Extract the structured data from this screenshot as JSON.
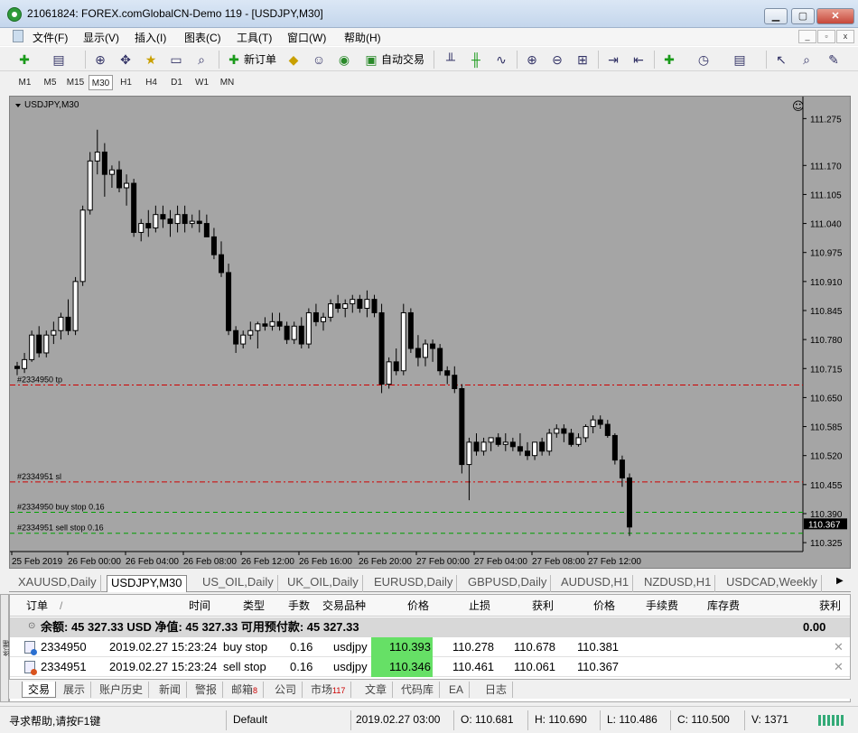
{
  "window": {
    "title": "21061824: FOREX.comGlobalCN-Demo 119 - [USDJPY,M30]"
  },
  "menu": [
    "文件(F)",
    "显示(V)",
    "插入(I)",
    "图表(C)",
    "工具(T)",
    "窗口(W)",
    "帮助(H)"
  ],
  "toolbar": {
    "new_order": "新订单",
    "auto_trade": "自动交易"
  },
  "timeframes": [
    "M1",
    "M5",
    "M15",
    "M30",
    "H1",
    "H4",
    "D1",
    "W1",
    "MN"
  ],
  "active_timeframe": "M30",
  "chart": {
    "symbol_label": "USDJPY,M30"
  },
  "chart_data": {
    "type": "candlestick",
    "title": "USDJPY,M30",
    "y_ticks": [
      "111.275",
      "111.170",
      "111.105",
      "111.040",
      "110.975",
      "110.910",
      "110.845",
      "110.780",
      "110.715",
      "110.650",
      "110.585",
      "110.520",
      "110.455",
      "110.390",
      "110.325"
    ],
    "x_ticks": [
      "25 Feb 2019",
      "26 Feb 00:00",
      "26 Feb 04:00",
      "26 Feb 08:00",
      "26 Feb 12:00",
      "26 Feb 16:00",
      "26 Feb 20:00",
      "27 Feb 00:00",
      "27 Feb 04:00",
      "27 Feb 08:00",
      "27 Feb 12:00"
    ],
    "current_price": "110.367",
    "ylim": [
      110.305,
      111.3
    ],
    "order_lines": [
      {
        "label": "#2334950 tp",
        "price": 110.678,
        "color": "#d00000",
        "style": "dashdot"
      },
      {
        "label": "#2334951 sl",
        "price": 110.461,
        "color": "#d00000",
        "style": "dashdot"
      },
      {
        "label": "#2334950 buy stop 0.16",
        "price": 110.393,
        "color": "#00a000",
        "style": "dash"
      },
      {
        "label": "#2334951 sell stop 0.16",
        "price": 110.346,
        "color": "#00a000",
        "style": "dash"
      }
    ],
    "candles": [
      [
        110.72,
        110.73,
        110.7,
        110.715
      ],
      [
        110.715,
        110.75,
        110.705,
        110.735
      ],
      [
        110.735,
        110.8,
        110.73,
        110.79
      ],
      [
        110.79,
        110.81,
        110.74,
        110.75
      ],
      [
        110.75,
        110.8,
        110.74,
        110.79
      ],
      [
        110.79,
        110.82,
        110.77,
        110.8
      ],
      [
        110.8,
        110.84,
        110.78,
        110.83
      ],
      [
        110.83,
        110.87,
        110.79,
        110.8
      ],
      [
        110.8,
        110.92,
        110.79,
        110.91
      ],
      [
        110.91,
        111.08,
        110.9,
        111.07
      ],
      [
        111.07,
        111.2,
        111.06,
        111.18
      ],
      [
        111.18,
        111.25,
        111.15,
        111.2
      ],
      [
        111.2,
        111.22,
        111.1,
        111.15
      ],
      [
        111.15,
        111.17,
        111.12,
        111.16
      ],
      [
        111.16,
        111.18,
        111.11,
        111.12
      ],
      [
        111.12,
        111.15,
        111.08,
        111.13
      ],
      [
        111.13,
        111.14,
        111.01,
        111.02
      ],
      [
        111.02,
        111.05,
        111.0,
        111.04
      ],
      [
        111.04,
        111.07,
        111.01,
        111.03
      ],
      [
        111.03,
        111.08,
        111.02,
        111.06
      ],
      [
        111.06,
        111.08,
        111.03,
        111.05
      ],
      [
        111.05,
        111.07,
        111.01,
        111.04
      ],
      [
        111.04,
        111.08,
        111.02,
        111.06
      ],
      [
        111.06,
        111.08,
        111.02,
        111.04
      ],
      [
        111.04,
        111.06,
        111.03,
        111.045
      ],
      [
        111.045,
        111.07,
        111.02,
        111.04
      ],
      [
        111.04,
        111.06,
        111.01,
        111.01
      ],
      [
        111.01,
        111.03,
        110.96,
        110.97
      ],
      [
        110.97,
        111.0,
        110.92,
        110.93
      ],
      [
        110.93,
        110.95,
        110.79,
        110.8
      ],
      [
        110.8,
        110.81,
        110.75,
        110.77
      ],
      [
        110.77,
        110.8,
        110.76,
        110.79
      ],
      [
        110.79,
        110.82,
        110.78,
        110.8
      ],
      [
        110.8,
        110.82,
        110.76,
        110.815
      ],
      [
        110.815,
        110.83,
        110.8,
        110.81
      ],
      [
        110.81,
        110.84,
        110.8,
        110.82
      ],
      [
        110.82,
        110.84,
        110.8,
        110.81
      ],
      [
        110.81,
        110.82,
        110.77,
        110.78
      ],
      [
        110.78,
        110.82,
        110.77,
        110.81
      ],
      [
        110.81,
        110.83,
        110.76,
        110.77
      ],
      [
        110.77,
        110.85,
        110.76,
        110.84
      ],
      [
        110.84,
        110.86,
        110.81,
        110.82
      ],
      [
        110.82,
        110.84,
        110.8,
        110.83
      ],
      [
        110.83,
        110.87,
        110.82,
        110.86
      ],
      [
        110.86,
        110.88,
        110.84,
        110.85
      ],
      [
        110.85,
        110.87,
        110.83,
        110.86
      ],
      [
        110.86,
        110.88,
        110.84,
        110.87
      ],
      [
        110.87,
        110.88,
        110.84,
        110.85
      ],
      [
        110.85,
        110.89,
        110.83,
        110.87
      ],
      [
        110.87,
        110.88,
        110.83,
        110.84
      ],
      [
        110.84,
        110.86,
        110.66,
        110.68
      ],
      [
        110.68,
        110.74,
        110.67,
        110.73
      ],
      [
        110.73,
        110.76,
        110.7,
        110.71
      ],
      [
        110.71,
        110.86,
        110.7,
        110.84
      ],
      [
        110.84,
        110.85,
        110.75,
        110.76
      ],
      [
        110.76,
        110.79,
        110.72,
        110.74
      ],
      [
        110.74,
        110.78,
        110.72,
        110.77
      ],
      [
        110.77,
        110.78,
        110.73,
        110.76
      ],
      [
        110.76,
        110.77,
        110.7,
        110.71
      ],
      [
        110.71,
        110.72,
        110.68,
        110.7
      ],
      [
        110.7,
        110.72,
        110.66,
        110.67
      ],
      [
        110.67,
        110.68,
        110.48,
        110.5
      ],
      [
        110.5,
        110.56,
        110.42,
        110.55
      ],
      [
        110.55,
        110.57,
        110.52,
        110.53
      ],
      [
        110.53,
        110.56,
        110.52,
        110.55
      ],
      [
        110.55,
        110.56,
        110.53,
        110.56
      ],
      [
        110.56,
        110.57,
        110.54,
        110.545
      ],
      [
        110.545,
        110.57,
        110.53,
        110.55
      ],
      [
        110.55,
        110.56,
        110.53,
        110.54
      ],
      [
        110.54,
        110.57,
        110.52,
        110.53
      ],
      [
        110.53,
        110.55,
        110.51,
        110.52
      ],
      [
        110.52,
        110.55,
        110.51,
        110.55
      ],
      [
        110.55,
        110.56,
        110.52,
        110.53
      ],
      [
        110.53,
        110.58,
        110.52,
        110.57
      ],
      [
        110.57,
        110.59,
        110.56,
        110.58
      ],
      [
        110.58,
        110.59,
        110.55,
        110.57
      ],
      [
        110.57,
        110.58,
        110.54,
        110.545
      ],
      [
        110.545,
        110.57,
        110.54,
        110.56
      ],
      [
        110.56,
        110.59,
        110.55,
        110.585
      ],
      [
        110.585,
        110.61,
        110.57,
        110.6
      ],
      [
        110.6,
        110.61,
        110.58,
        110.59
      ],
      [
        110.59,
        110.6,
        110.56,
        110.565
      ],
      [
        110.565,
        110.57,
        110.5,
        110.51
      ],
      [
        110.51,
        110.52,
        110.45,
        110.47
      ],
      [
        110.47,
        110.48,
        110.34,
        110.36
      ]
    ]
  },
  "symbol_tabs": [
    "XAUUSD,Daily",
    "USDJPY,M30",
    "US_OIL,Daily",
    "UK_OIL,Daily",
    "EURUSD,Daily",
    "GBPUSD,Daily",
    "AUDUSD,H1",
    "NZDUSD,H1",
    "USDCAD,Weekly"
  ],
  "terminal": {
    "headers": [
      "订单",
      "/",
      "时间",
      "类型",
      "手数",
      "交易品种",
      "价格",
      "止损",
      "获利",
      "价格",
      "手续费",
      "库存费",
      "获利"
    ],
    "balance_text": "余额: 45 327.33 USD  净值: 45 327.33  可用预付款: 45 327.33",
    "balance_profit": "0.00",
    "orders": [
      {
        "order": "2334950",
        "time": "2019.02.27 15:23:24",
        "type": "buy stop",
        "volume": "0.16",
        "symbol": "usdjpy",
        "price": "110.393",
        "sl": "110.278",
        "tp": "110.678",
        "cur_price": "110.381"
      },
      {
        "order": "2334951",
        "time": "2019.02.27 15:23:24",
        "type": "sell stop",
        "volume": "0.16",
        "symbol": "usdjpy",
        "price": "110.346",
        "sl": "110.461",
        "tp": "110.061",
        "cur_price": "110.367"
      }
    ],
    "vertical_label": "终端",
    "tabs": [
      {
        "label": "交易",
        "badge": ""
      },
      {
        "label": "展示",
        "badge": ""
      },
      {
        "label": "账户历史",
        "badge": ""
      },
      {
        "label": "新闻",
        "badge": ""
      },
      {
        "label": "警报",
        "badge": ""
      },
      {
        "label": "邮箱",
        "badge": "8"
      },
      {
        "label": "公司",
        "badge": ""
      },
      {
        "label": "市场",
        "badge": "117"
      },
      {
        "label": "文章",
        "badge": ""
      },
      {
        "label": "代码库",
        "badge": ""
      },
      {
        "label": "EA",
        "badge": ""
      },
      {
        "label": "日志",
        "badge": ""
      }
    ]
  },
  "status": {
    "help": "寻求帮助,请按F1键",
    "profile": "Default",
    "datetime": "2019.02.27 03:00",
    "open": "O: 110.681",
    "high": "H: 110.690",
    "low": "L: 110.486",
    "close": "C: 110.500",
    "volume": "V: 1371"
  },
  "colors": {
    "chart_bg": "#a5a5a5",
    "bull": "#ffffff",
    "bear": "#000000",
    "sl_tp_line": "#d00000",
    "pending_line": "#00a000",
    "price_highlight": "#66e066"
  }
}
